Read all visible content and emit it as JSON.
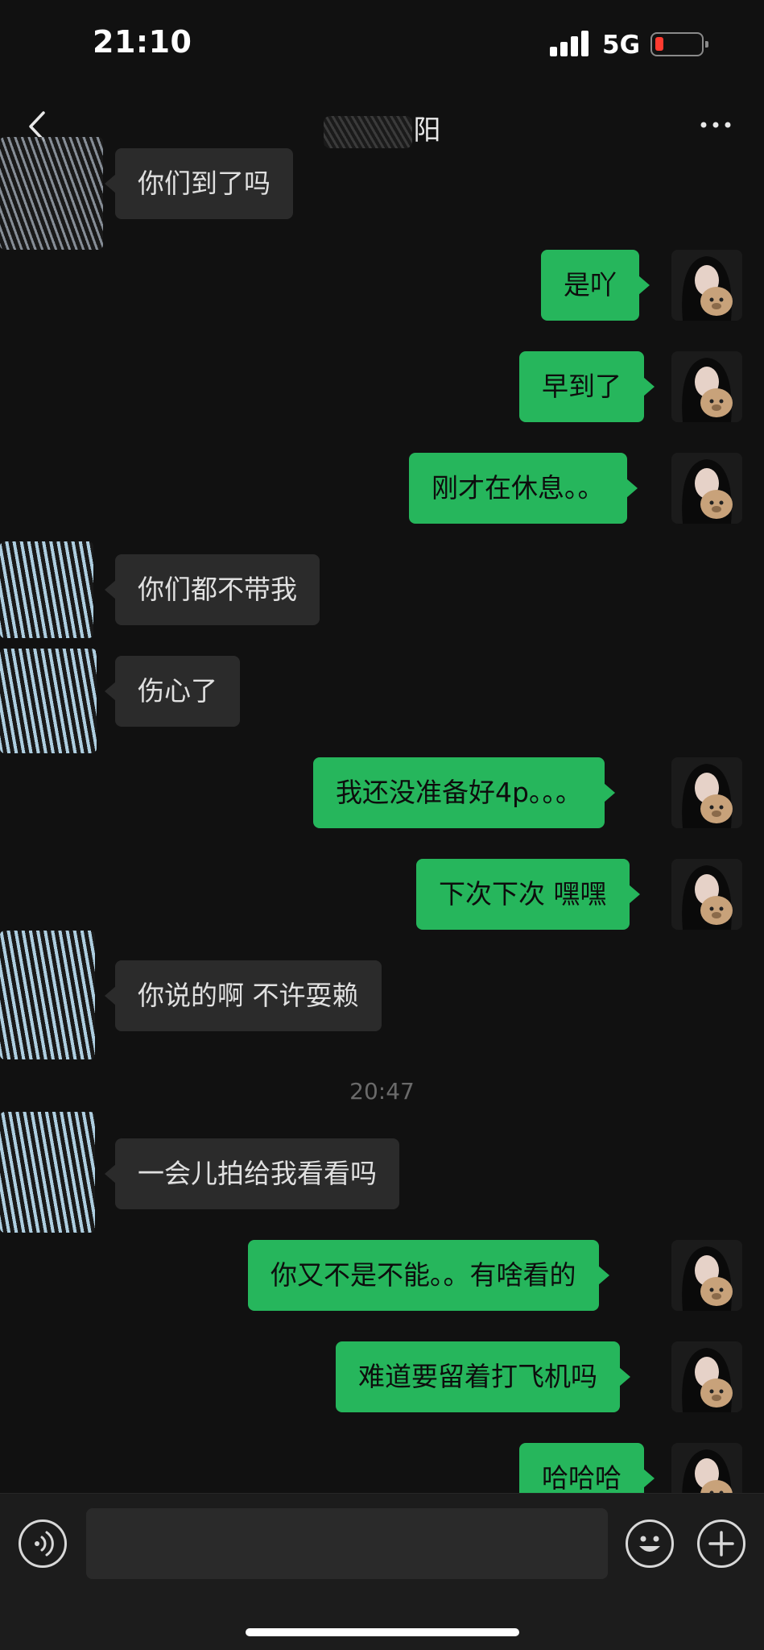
{
  "status_bar": {
    "time": "21:10",
    "network": "5G"
  },
  "nav": {
    "title": "阳",
    "back_icon": "chevron-left-icon",
    "more_icon": "ellipsis-icon"
  },
  "messages": [
    {
      "side": "in",
      "text": "你们到了吗"
    },
    {
      "side": "out",
      "text": "是吖"
    },
    {
      "side": "out",
      "text": "早到了"
    },
    {
      "side": "out",
      "text": "刚才在休息。。"
    },
    {
      "side": "in",
      "text": "你们都不带我"
    },
    {
      "side": "in",
      "text": "伤心了"
    },
    {
      "side": "out",
      "text": "我还没准备好4p。。。"
    },
    {
      "side": "out",
      "text": "下次下次 嘿嘿"
    },
    {
      "side": "in",
      "text": "你说的啊 不许耍赖"
    },
    {
      "side": "in",
      "text": "一会儿拍给我看看吗"
    },
    {
      "side": "out",
      "text": "你又不是不能。。有啥看的"
    },
    {
      "side": "out",
      "text": "难道要留着打飞机吗"
    },
    {
      "side": "out",
      "text": "哈哈哈"
    }
  ],
  "timestamp": "20:47",
  "input_bar": {
    "voice_icon": "voice-icon",
    "emoji_icon": "emoji-icon",
    "plus_icon": "plus-icon",
    "input_value": ""
  },
  "colors": {
    "background": "#111111",
    "incoming_bubble": "#2b2b2b",
    "outgoing_bubble": "#26b65c",
    "battery_low": "#ff3b30"
  }
}
